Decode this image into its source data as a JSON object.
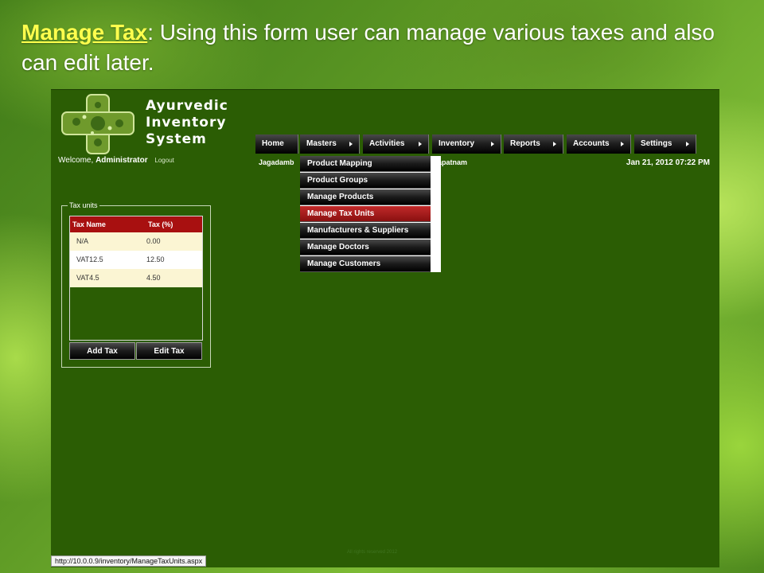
{
  "slide": {
    "title_keyword": "Manage Tax",
    "title_rest": ": Using this form user can manage various taxes and also can edit later."
  },
  "app": {
    "logo_lines": [
      "Ayurvedic",
      "Inventory",
      "System"
    ],
    "welcome_prefix": "Welcome, ",
    "user": "Administrator",
    "logout": "Logout",
    "location_left": "Jagadamb",
    "location_right": "apatnam",
    "datetime": "Jan 21, 2012 07:22 PM",
    "footer": "All rights reserved 2012",
    "status_url": "http://10.0.0.9/inventory/ManageTaxUnits.aspx"
  },
  "nav": {
    "items": [
      {
        "label": "Home",
        "has_arrow": false
      },
      {
        "label": "Masters",
        "has_arrow": true
      },
      {
        "label": "Activities",
        "has_arrow": true
      },
      {
        "label": "Inventory",
        "has_arrow": true
      },
      {
        "label": "Reports",
        "has_arrow": true
      },
      {
        "label": "Accounts",
        "has_arrow": true
      },
      {
        "label": "Settings",
        "has_arrow": true
      }
    ]
  },
  "masters_menu": {
    "items": [
      {
        "label": "Product Mapping",
        "has_arrow": true,
        "active": false
      },
      {
        "label": "Product Groups",
        "active": false
      },
      {
        "label": "Manage Products",
        "active": false
      },
      {
        "label": "Manage Tax Units",
        "active": true
      },
      {
        "label": "Manufacturers & Suppliers",
        "active": false
      },
      {
        "label": "Manage Doctors",
        "active": false
      },
      {
        "label": "Manage Customers",
        "active": false
      }
    ]
  },
  "tax_units": {
    "legend": "Tax units",
    "columns": [
      "Tax Name",
      "Tax (%)"
    ],
    "rows": [
      {
        "name": "N/A",
        "tax": "0.00"
      },
      {
        "name": "VAT12.5",
        "tax": "12.50"
      },
      {
        "name": "VAT4.5",
        "tax": "4.50"
      }
    ],
    "add_button": "Add Tax",
    "edit_button": "Edit Tax"
  },
  "colors": {
    "app_background": "#2b5d04",
    "active_menu": "#a81010",
    "header_row": "#a81010",
    "title_keyword": "#ffff4d"
  }
}
